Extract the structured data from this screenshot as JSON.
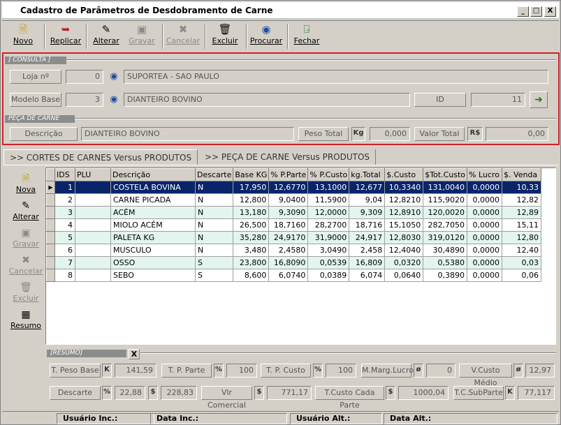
{
  "window": {
    "title": "Cadastro de Parâmetros de Desdobramento de Carne",
    "min_label": "_",
    "max_label": "□",
    "close_label": "X"
  },
  "toolbar": {
    "novo": "Novo",
    "replicar": "Replicar",
    "alterar": "Alterar",
    "gravar": "Gravar",
    "cancelar": "Cancelar",
    "excluir": "Excluir",
    "procurar": "Procurar",
    "fechar": "Fechar"
  },
  "consulta": {
    "header": "[ CONSULTA ]",
    "loja_label": "Loja nº",
    "loja_num": "0",
    "loja_nome": "SUPORTEA - SAO PAULO",
    "modelo_label": "Modelo Base",
    "modelo_num": "3",
    "modelo_nome": "DIANTEIRO BOVINO",
    "id_label": "ID",
    "id_value": "11"
  },
  "peca": {
    "header": "PEÇA DE CARNE",
    "descricao_label": "Descrição",
    "descricao_value": "DIANTEIRO BOVINO",
    "peso_label": "Peso Total",
    "peso_unit": "Kg",
    "peso_value": "0,000",
    "valor_label": "Valor Total",
    "valor_unit": "R$",
    "valor_value": "0,00"
  },
  "tabs": {
    "tab1": ">> CORTES DE CARNES Versus PRODUTOS",
    "tab2": ">> PEÇA DE CARNE Versus PRODUTOS"
  },
  "side": {
    "nova": "Nova",
    "alterar": "Alterar",
    "gravar": "Gravar",
    "cancelar": "Cancelar",
    "excluir": "Excluir",
    "resumo": "Resumo"
  },
  "grid": {
    "columns": [
      "IDS",
      "PLU",
      "Descrição",
      "Descarte",
      "Base KG",
      "% P.Parte",
      "% P.Custo",
      "kg.Total",
      "$.Custo",
      "$Tot.Custo",
      "% Lucro",
      "$. Venda"
    ],
    "rows": [
      [
        "1",
        "",
        "COSTELA BOVINA",
        "N",
        "17,950",
        "12,6770",
        "13,1000",
        "12,677",
        "10,3340",
        "131,0040",
        "0,0000",
        "10,33"
      ],
      [
        "2",
        "",
        "CARNE PICADA",
        "N",
        "12,800",
        "9,0400",
        "11,5900",
        "9,04",
        "12,8210",
        "115,9020",
        "0,0000",
        "12,82"
      ],
      [
        "3",
        "",
        "ACÉM",
        "N",
        "13,180",
        "9,3090",
        "12,0000",
        "9,309",
        "12,8910",
        "120,0020",
        "0,0000",
        "12,89"
      ],
      [
        "4",
        "",
        "MIOLO ACÉM",
        "N",
        "26,500",
        "18,7160",
        "28,2700",
        "18,716",
        "15,1050",
        "282,7050",
        "0,0000",
        "15,11"
      ],
      [
        "5",
        "",
        "PALETA KG",
        "N",
        "35,280",
        "24,9170",
        "31,9000",
        "24,917",
        "12,8030",
        "319,0120",
        "0,0000",
        "12,80"
      ],
      [
        "6",
        "",
        "MUSCULO",
        "N",
        "3,480",
        "2,4580",
        "3,0490",
        "2,458",
        "12,4040",
        "30,4890",
        "0,0000",
        "12,40"
      ],
      [
        "7",
        "",
        "OSSO",
        "S",
        "23,800",
        "16,8090",
        "0,0539",
        "16,809",
        "0,0320",
        "0,5380",
        "0,0000",
        "0,03"
      ],
      [
        "8",
        "",
        "SEBO",
        "S",
        "8,600",
        "6,0740",
        "0,0389",
        "6,074",
        "0,0640",
        "0,3890",
        "0,0000",
        "0,06"
      ]
    ]
  },
  "resumo": {
    "header": "[RESUMO]",
    "close": "X",
    "peso_base_label": "T. Peso Base",
    "peso_base_unit": "K",
    "peso_base_value": "141,59",
    "p_parte_label": "T. P. Parte",
    "p_parte_unit": "%",
    "p_parte_value": "100",
    "p_custo_label": "T. P. Custo",
    "p_custo_unit": "%",
    "p_custo_value": "100",
    "marg_label": "M.Marg.Lucro",
    "marg_unit": "ø",
    "marg_value": "0",
    "vcusto_label": "V.Custo Médio",
    "vcusto_unit": "ø",
    "vcusto_value": "12,97",
    "descarte_label": "Descarte",
    "descarte_unit": "%",
    "descarte_value": "22,88",
    "descarte_unit2": "$",
    "descarte_value2": "228,83",
    "vlr_label": "Vlr Comercial",
    "vlr_unit": "$",
    "vlr_value": "771,17",
    "tcusto_label": "T.Custo Cada Parte",
    "tcusto_unit": "$",
    "tcusto_value": "1000,04",
    "tcsub_label": "T.C.SubParte",
    "tcsub_unit": "K",
    "tcsub_value": "77,117"
  },
  "status": {
    "usuario_inc": "Usuário Inc.:",
    "data_inc": "Data Inc.:",
    "usuario_alt": "Usuário Alt.:",
    "data_alt": "Data Alt.:"
  }
}
